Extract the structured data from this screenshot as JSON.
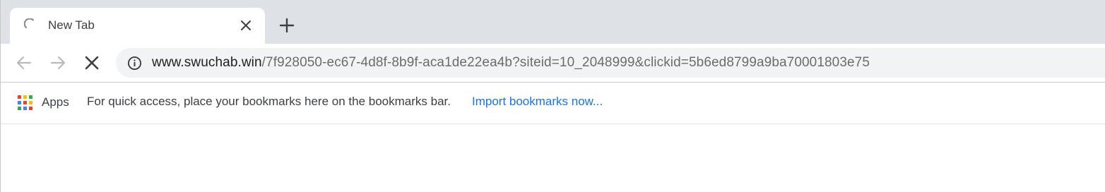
{
  "tabs": [
    {
      "title": "New Tab",
      "loading": true
    }
  ],
  "toolbar": {
    "url_host": "www.swuchab.win",
    "url_path": "/7f928050-ec67-4d8f-8b9f-aca1de22ea4b?siteid=10_2048999&clickid=5b6ed8799a9ba70001803e75"
  },
  "bookmarks_bar": {
    "apps_label": "Apps",
    "hint": "For quick access, place your bookmarks here on the bookmarks bar.",
    "import_link": "Import bookmarks now..."
  },
  "icons": {
    "spinner": "loading-spinner-icon",
    "close": "close-icon",
    "new_tab": "plus-icon",
    "back": "arrow-left-icon",
    "forward": "arrow-right-icon",
    "stop": "x-icon",
    "site_info": "info-circle-icon",
    "apps": "apps-grid-icon"
  },
  "colors": {
    "tabstrip_bg": "#dee1e6",
    "omnibox_bg": "#f1f3f4",
    "link": "#1a73e8",
    "spinner": "#8a8d91",
    "apps_grid": [
      "#ea4335",
      "#fbbc05",
      "#34a853",
      "#4285f4",
      "#ea4335",
      "#fbbc05",
      "#34a853",
      "#4285f4",
      "#ea4335"
    ]
  }
}
